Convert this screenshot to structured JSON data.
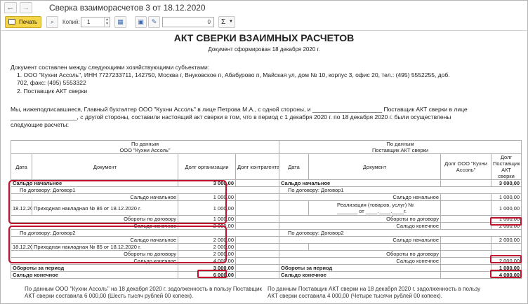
{
  "window": {
    "title": "Сверка взаиморасчетов 3 от 18.12.2020",
    "back_icon": "←",
    "forward_icon": "→"
  },
  "toolbar": {
    "print_label": "Печать",
    "copies_label": "Копий:",
    "copies_value": "1",
    "sum_value": "0",
    "sum_symbol": "Σ"
  },
  "document": {
    "title": "АКТ СВЕРКИ ВЗАИМНЫХ РАСЧЕТОВ",
    "subtitle": "Документ сформирован 18 декабря 2020 г.",
    "intro": "Документ составлен между следующими хозяйствующими субъектами:",
    "party1_line1": "1.  ООО \"Кухни Ассоль\",  ИНН 7727233711,  142750, Москва г, Внуковское п, Абабурово п, Майская ул, дом № 10, корпус 3, офис 20,  тел.: (495) 5552255, доб.",
    "party1_line2": "702,  факс: (495) 5553322",
    "party2": "2.  Поставщик АКТ сверки",
    "statement_line1": "Мы, нижеподписавшиеся, Главный бухгалтер  ООО \"Кухни Ассоль\" в лице Петрова М.А., с одной стороны, и _____________________  Поставщик АКТ сверки в лице",
    "statement_line2": "____________________, с другой стороны, составили настоящий акт сверки в том, что в период с 1 декабря 2020 г. по 18 декабря 2020 г. были осуществлены",
    "statement_line3": "следующие расчеты:"
  },
  "table": {
    "left_header": "По данным\nООО \"Кухни Ассоль\"",
    "right_header": "По данным\nПоставщик АКТ сверки",
    "col_date": "Дата",
    "col_doc": "Документ",
    "col_debt_org": "Долг организации",
    "col_debt_cp": "Долг контрагента",
    "col_debt_kuhni": "Долг  ООО \"Кухни Ассоль\"",
    "col_debt_supplier": "Долг  Поставщик АКТ сверки",
    "saldo_start_label": "Сальдо начальное",
    "saldo_start_left": "3 000,00",
    "saldo_start_right": "3 000,00",
    "contract1": {
      "label": "По договору: Договор1",
      "start_label": "Сальдо начальное",
      "start_left": "1 000,00",
      "start_right": "1 000,00",
      "date": "18.12.20",
      "left_doc": "Приходная накладная № 86 от 18.12.2020 г.",
      "left_amount": "1 000,00",
      "right_doc_line1": "Реализация (товаров, услуг) №",
      "right_doc_line2": "_______ от ____.____.____г.",
      "right_amount": "1 000,00",
      "turnover_label": "Обороты по договору",
      "turnover_left": "1 000,00",
      "turnover_right": "1 000,00",
      "end_label": "Сальдо конечное",
      "end_left": "2 000,00",
      "end_right": "2 000,00"
    },
    "contract2": {
      "label": "По договору: Договор2",
      "start_label": "Сальдо начальное",
      "start_left": "2 000,00",
      "start_right": "2 000,00",
      "date": "18.12.20",
      "left_doc": "Приходная накладная № 85 от 18.12.2020 г.",
      "left_amount": "2 000,00",
      "turnover_label": "Обороты по договору",
      "turnover_left": "2 000,00",
      "end_label": "Сальдо конечное",
      "end_left": "4 000,00",
      "end_right": "2 000,00"
    },
    "period_label": "Обороты за период",
    "period_left": "3 000,00",
    "period_right": "1 000,00",
    "saldo_end_label": "Сальдо конечное",
    "saldo_end_left": "6 000,00",
    "saldo_end_right": "4 000,00"
  },
  "footer": {
    "left_line1": "По данным  ООО \"Кухни Ассоль\" на 18 декабря 2020 г. задолженность в пользу  Поставщик",
    "left_line2": "АКТ сверки составила 6 000,00  (Шесть тысяч рублей 00 копеек).",
    "right_line1": "По данным  Поставщик АКТ сверки на 18 декабря 2020 г. задолженность в пользу",
    "right_line2": "АКТ сверки составила 4 000,00  (Четыре тысячи рублей 00 копеек)."
  },
  "colors": {
    "highlight": "#c0102b",
    "print_button": "#f5d54a"
  }
}
